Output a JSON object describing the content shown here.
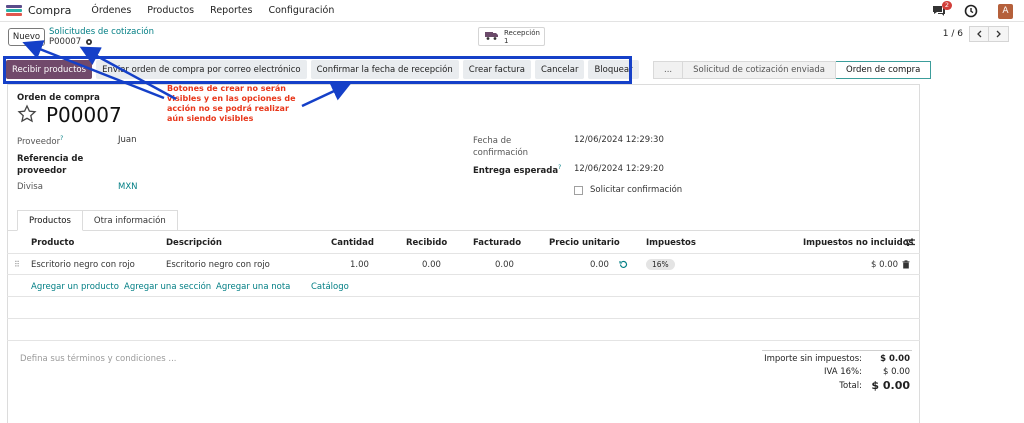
{
  "navbar": {
    "app_name": "Compra",
    "menu": [
      "Órdenes",
      "Productos",
      "Reportes",
      "Configuración"
    ],
    "chat_count": "2",
    "avatar_initial": "A",
    "logo_colors": [
      "#5b4b8a",
      "#2bb2a6",
      "#e0564d"
    ]
  },
  "control": {
    "new_label": "Nuevo",
    "breadcrumb_parent": "Solicitudes de cotización",
    "breadcrumb_current": "P00007",
    "smart_button": {
      "label": "Recepción",
      "count": "1"
    },
    "pager_value": "1 / 6"
  },
  "actions": {
    "buttons": [
      "Recibir productos",
      "Enviar orden de compra por correo electrónico",
      "Confirmar la fecha de recepción",
      "Crear factura",
      "Cancelar",
      "Bloquear"
    ]
  },
  "statusbar": {
    "stages": [
      "...",
      "Solicitud de cotización enviada",
      "Orden de compra"
    ],
    "active_stage": "Orden de compra"
  },
  "annotation": "Botones de crear no serán visibles y en las opciones de acción no se podrá realizar aún siendo visibles",
  "form": {
    "doc_label": "Orden de compra",
    "doc_name": "P00007",
    "proveedor_label": "Proveedor",
    "proveedor_value": "Juan",
    "referencia_label": "Referencia de proveedor",
    "divisa_label": "Divisa",
    "divisa_value": "MXN",
    "fecha_conf_label": "Fecha de confirmación",
    "fecha_conf_value": "12/06/2024 12:29:30",
    "entrega_label": "Entrega esperada",
    "entrega_value": "12/06/2024 12:29:20",
    "solicitar_label": "Solicitar confirmación"
  },
  "tabs": [
    "Productos",
    "Otra información"
  ],
  "table": {
    "headers": [
      "Producto",
      "Descripción",
      "Cantidad",
      "Recibido",
      "Facturado",
      "Precio unitario",
      "Impuestos",
      "Impuestos no incluidos"
    ],
    "row": {
      "producto": "Escritorio negro con rojo",
      "descripcion": "Escritorio negro con rojo",
      "cantidad": "1.00",
      "recibido": "0.00",
      "facturado": "0.00",
      "precio": "0.00",
      "impuesto": "16%",
      "subtotal": "$ 0.00"
    },
    "add_links": [
      "Agregar un producto",
      "Agregar una sección",
      "Agregar una nota",
      "Catálogo"
    ]
  },
  "footer": {
    "terms_placeholder": "Defina sus términos y condiciones ...",
    "untaxed_label": "Importe sin impuestos:",
    "untaxed_value": "$ 0.00",
    "iva_label": "IVA 16%:",
    "iva_value": "$ 0.00",
    "total_label": "Total:",
    "total_value": "$ 0.00"
  },
  "colors": {
    "primary": "#71496b",
    "link": "#017e84",
    "annotation": "#e8361a",
    "highlight": "#1540c8"
  }
}
